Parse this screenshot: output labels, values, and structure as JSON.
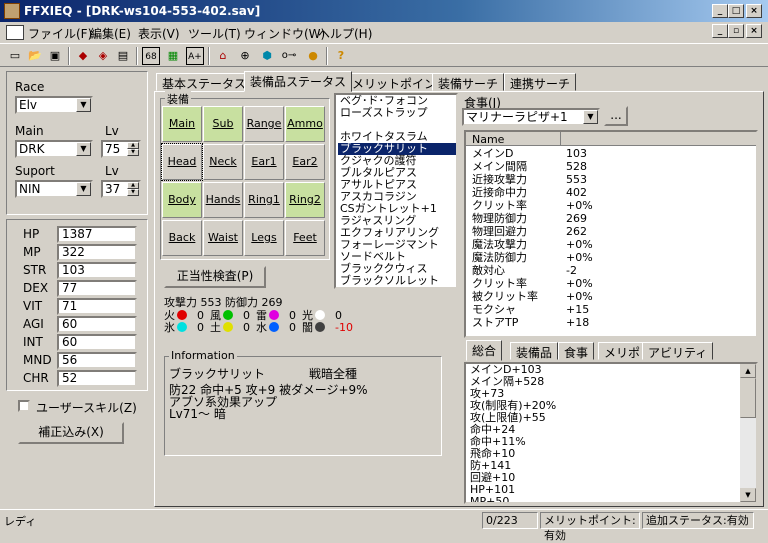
{
  "window": {
    "title": "FFXIEQ - [DRK-ws104-553-402.sav]"
  },
  "menu": [
    "ファイル(F)",
    "編集(E)",
    "表示(V)",
    "ツール(T)",
    "ウィンドウ(W)",
    "ヘルプ(H)"
  ],
  "toolbar": {
    "icons": [
      "new-icon",
      "open-icon",
      "save-icon",
      "tool1-icon",
      "tool2-icon",
      "tool3-icon",
      "set68-icon",
      "grid-icon",
      "aplus-icon",
      "house-icon",
      "target-icon",
      "cube-icon",
      "key-icon",
      "hat-icon",
      "help-icon"
    ],
    "labels": {
      "set68": "68",
      "aplus": "A+"
    }
  },
  "left": {
    "race_label": "Race",
    "race": "Elv",
    "main_label": "Main",
    "main": "DRK",
    "lv_label": "Lv",
    "main_lv": "75",
    "sup_label": "Suport",
    "sup": "NIN",
    "sup_lv_label": "Lv",
    "sup_lv": "37",
    "stats": [
      {
        "k": "HP",
        "v": "1387"
      },
      {
        "k": "MP",
        "v": "322"
      },
      {
        "k": "STR",
        "v": "103"
      },
      {
        "k": "DEX",
        "v": "77"
      },
      {
        "k": "VIT",
        "v": "71"
      },
      {
        "k": "AGI",
        "v": "60"
      },
      {
        "k": "INT",
        "v": "60"
      },
      {
        "k": "MND",
        "v": "56"
      },
      {
        "k": "CHR",
        "v": "52"
      }
    ],
    "user_skill": "ユーザースキル(Z)",
    "adjust_btn": "補正込み(X)"
  },
  "tabs": [
    "基本ステータス",
    "装備品ステータス",
    "メリットポイント",
    "装備サーチ",
    "連携サーチ"
  ],
  "equip": {
    "title": "装備",
    "slots": [
      "Main",
      "Sub",
      "Range",
      "Ammo",
      "Head",
      "Neck",
      "Ear1",
      "Ear2",
      "Body",
      "Hands",
      "Ring1",
      "Ring2",
      "Back",
      "Waist",
      "Legs",
      "Feet"
    ],
    "check_btn": "正当性検査(P)",
    "attack_line": "攻撃力 553 防御力 269",
    "elements": [
      {
        "k": "火",
        "v": "0",
        "c": "#e00000"
      },
      {
        "k": "風",
        "v": "0",
        "c": "#00c000"
      },
      {
        "k": "雷",
        "v": "0",
        "c": "#e000e0"
      },
      {
        "k": "光",
        "v": "0",
        "c": "#ffffff"
      },
      {
        "k": "氷",
        "v": "0",
        "c": "#00e0e0"
      },
      {
        "k": "土",
        "v": "0",
        "c": "#e0e000"
      },
      {
        "k": "水",
        "v": "0",
        "c": "#0060ff"
      },
      {
        "k": "闇",
        "v": "-10",
        "c": "#404040"
      }
    ]
  },
  "item_list": [
    "ベグ･ド･フォコン",
    "ローズストラップ",
    "",
    "ホワイトタスラム",
    "ブラックサリット",
    "クジャクの護符",
    "ブルタルピアス",
    "アサルトピアス",
    "アスカコラジン",
    "CSガントレット+1",
    "ラジャスリング",
    "エクフォリアリング",
    "フォーレージマント",
    "ソードベルト",
    "ブラッククウィス",
    "ブラックソルレット"
  ],
  "info": {
    "title": "Information",
    "name": "ブラックサリット",
    "jobs": "戦暗全種",
    "line1": "防22 命中+5 攻+9 被ダメージ+9%",
    "line2": "アブソ系効果アップ",
    "line3": "Lv71～ 暗"
  },
  "food": {
    "label": "食事(J)",
    "value": "マリナーラピザ+1",
    "btn": "..."
  },
  "grid": {
    "header": "Name",
    "rows": [
      {
        "n": "メインD",
        "v": "103"
      },
      {
        "n": "メイン間隔",
        "v": "528"
      },
      {
        "n": "近接攻撃力",
        "v": "553"
      },
      {
        "n": "近接命中力",
        "v": "402"
      },
      {
        "n": "クリット率",
        "v": "+0%"
      },
      {
        "n": "物理防御力",
        "v": "269"
      },
      {
        "n": "物理回避力",
        "v": "262"
      },
      {
        "n": "魔法攻撃力",
        "v": "+0%"
      },
      {
        "n": "魔法防御力",
        "v": "+0%"
      },
      {
        "n": "敵対心",
        "v": "-2"
      },
      {
        "n": "クリット率",
        "v": "+0%"
      },
      {
        "n": "被クリット率",
        "v": "+0%"
      },
      {
        "n": "モクシャ",
        "v": "+15"
      },
      {
        "n": "ストアTP",
        "v": "+18"
      }
    ]
  },
  "bottom_tabs": [
    "総合",
    "装備品",
    "食事",
    "メリポ",
    "アビリティ"
  ],
  "summary": [
    "メインD+103",
    "メイン隔+528",
    "攻+73",
    "攻(制限有)+20%",
    "攻(上限値)+55",
    "命中+24",
    "命中+11%",
    "飛命+10",
    "防+141",
    "回避+10",
    "HP+101",
    "MP+50"
  ],
  "status": {
    "left": "レディ",
    "count": "0/223",
    "merit": "メリットポイント:有効",
    "extra": "追加ステータス:有効"
  }
}
